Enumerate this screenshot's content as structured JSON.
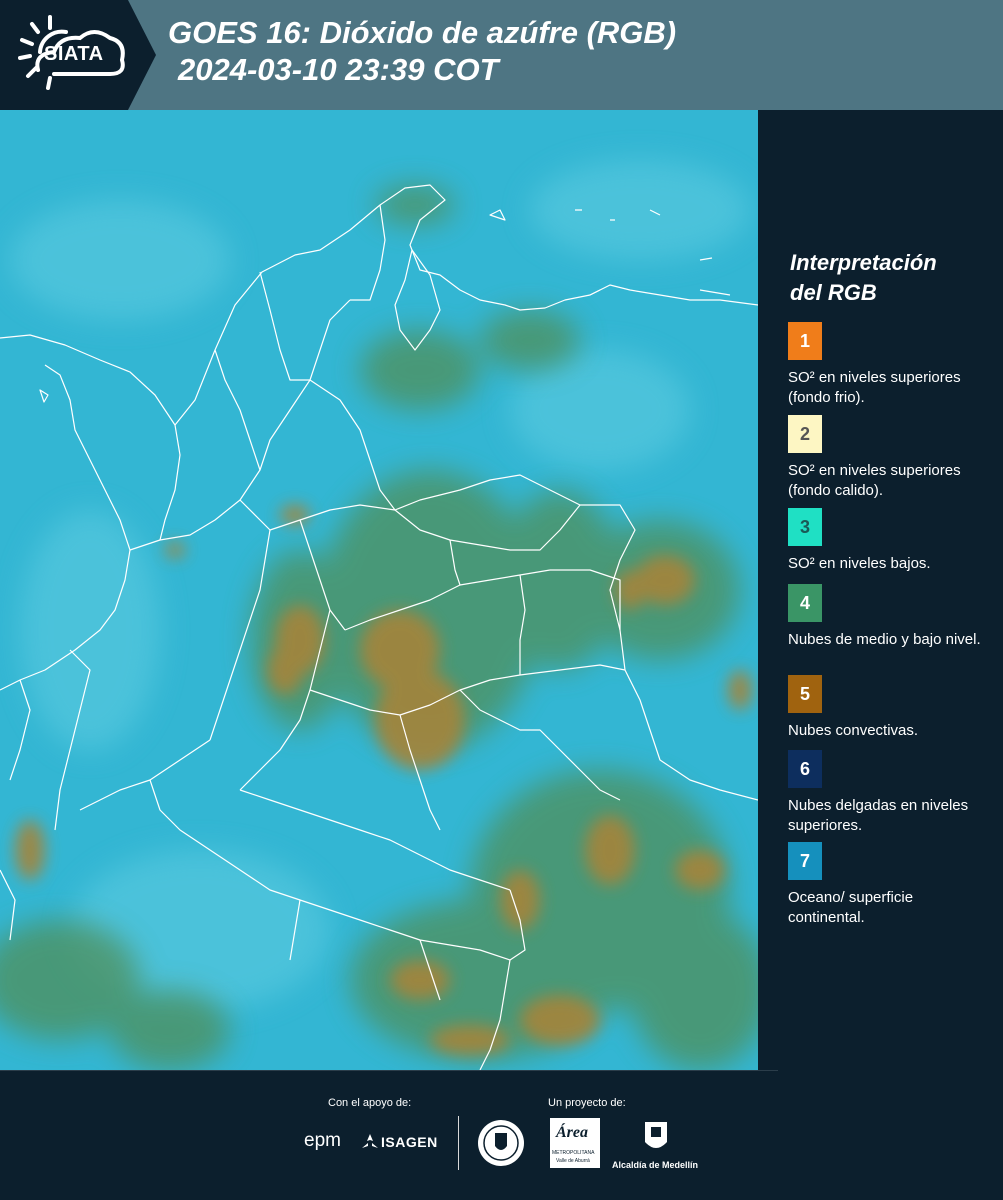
{
  "header": {
    "brand": "SIATA",
    "title_line1": "GOES 16: Dióxido de azúfre (RGB)",
    "title_line2": "2024-03-10 23:39 COT"
  },
  "legend": {
    "title_line1": "Interpretación",
    "title_line2": "del RGB",
    "items": [
      {
        "num": "1",
        "label": "SO² en niveles superiores (fondo frio).",
        "color": "#f07d1a",
        "text_color": "#ffffff"
      },
      {
        "num": "2",
        "label": "SO² en niveles superiores (fondo calido).",
        "color": "#fdf6c3",
        "text_color": "#555555"
      },
      {
        "num": "3",
        "label": "SO² en niveles bajos.",
        "color": "#1fe0c4",
        "text_color": "#1a5a56"
      },
      {
        "num": "4",
        "label": "Nubes de medio y bajo nivel.",
        "color": "#3a9566",
        "text_color": "#ffffff"
      },
      {
        "num": "5",
        "label": "Nubes convectivas.",
        "color": "#a0630f",
        "text_color": "#ffffff"
      },
      {
        "num": "6",
        "label": "Nubes delgadas en niveles superiores.",
        "color": "#0d2e5e",
        "text_color": "#ffffff"
      },
      {
        "num": "7",
        "label": "Oceano/ superficie continental.",
        "color": "#1590bd",
        "text_color": "#ffffff"
      }
    ]
  },
  "footer": {
    "support_label": "Con el apoyo de:",
    "project_label": "Un proyecto de:",
    "sponsor1": "epm",
    "sponsor2": "ISAGEN",
    "partner_area": "Área",
    "partner_area_sub1": "METROPOLITANA",
    "partner_area_sub2": "Valle de Aburrá",
    "partner_alcaldia": "Alcaldía de Medellín"
  },
  "colors": {
    "header_bg": "#4e7583",
    "logo_panel": "#0c1f2d",
    "map_base": "#33b6d3",
    "map_green": "#4f8f5a",
    "map_brown": "#a5843a",
    "boundary": "#ffffff"
  }
}
